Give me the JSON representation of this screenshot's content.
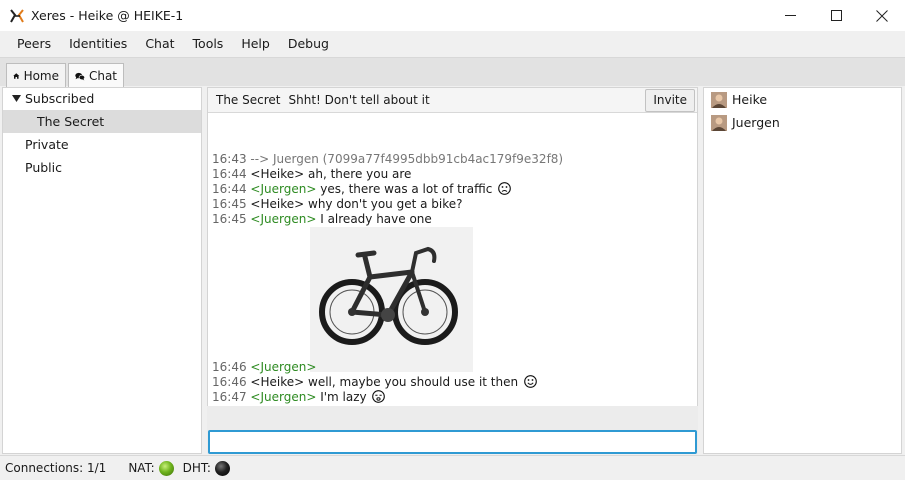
{
  "window": {
    "title": "Xeres - Heike @ HEIKE-1"
  },
  "menu": [
    "Peers",
    "Identities",
    "Chat",
    "Tools",
    "Help",
    "Debug"
  ],
  "tabs": [
    {
      "label": "Home",
      "icon": "home-icon"
    },
    {
      "label": "Chat",
      "icon": "chat-bubbles-icon"
    }
  ],
  "rooms": {
    "subscribed_label": "Subscribed",
    "selected_room": "The Secret",
    "private_label": "Private",
    "public_label": "Public"
  },
  "chat": {
    "room_name": "The Secret",
    "topic": "Shht! Don't tell about it",
    "invite_label": "Invite",
    "messages": [
      {
        "time": "16:43",
        "text": "--> Juergen (7099a77f4995dbb91cb4ac179f9e32f8)"
      },
      {
        "time": "16:44",
        "nick": "<Heike>",
        "text": "ah, there you are"
      },
      {
        "time": "16:44",
        "nick": "<Juergen>",
        "text": "yes, there was a lot of traffic"
      },
      {
        "time": "16:45",
        "nick": "<Heike>",
        "text": "why don't you get a bike?"
      },
      {
        "time": "16:45",
        "nick": "<Juergen>",
        "text": "I already have one"
      },
      {
        "time": "16:46",
        "nick": "<Juergen>",
        "text": ""
      },
      {
        "time": "16:46",
        "nick": "<Heike>",
        "text": "well, maybe you should use it then"
      },
      {
        "time": "16:47",
        "nick": "<Juergen>",
        "text": "I'm lazy"
      }
    ],
    "input_value": ""
  },
  "users": [
    "Heike",
    "Juergen"
  ],
  "status": {
    "connections": "Connections: 1/1",
    "nat_label": "NAT:",
    "dht_label": "DHT:"
  },
  "colors": {
    "nick_other": "#2e8b22",
    "focus_border": "#2f9ad3",
    "nat_ok": "#6fb31d",
    "dht_off": "#000000"
  }
}
